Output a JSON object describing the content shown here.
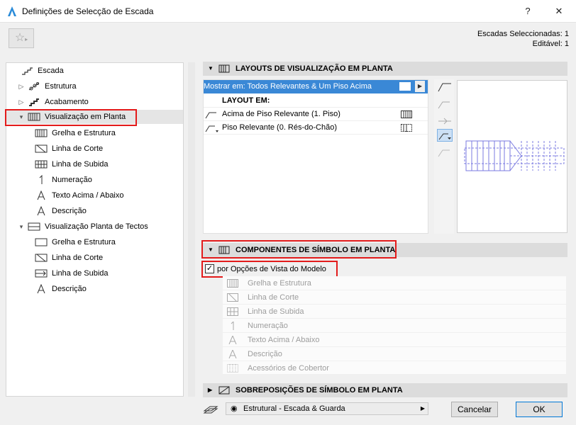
{
  "window": {
    "title": "Definições de Selecção de Escada",
    "help": "?",
    "close": "✕"
  },
  "selection_info": {
    "selected": "Escadas Seleccionadas: 1",
    "editable": "Editável: 1"
  },
  "tree": {
    "root": "Escada",
    "items": [
      {
        "label": "Estrutura",
        "icon": "stair-structure-icon"
      },
      {
        "label": "Acabamento",
        "icon": "stair-finish-icon"
      },
      {
        "label": "Visualização em Planta",
        "icon": "floor-plan-display-icon",
        "selected": true
      },
      {
        "label": "Grelha e Estrutura",
        "icon": "grid-structure-icon"
      },
      {
        "label": "Linha de Corte",
        "icon": "break-line-icon"
      },
      {
        "label": "Linha de Subida",
        "icon": "walking-line-icon"
      },
      {
        "label": "Numeração",
        "icon": "numbering-icon"
      },
      {
        "label": "Texto Acima / Abaixo",
        "icon": "up-down-text-icon"
      },
      {
        "label": "Descrição",
        "icon": "description-icon"
      },
      {
        "label": "Visualização Planta de Tectos",
        "icon": "ceiling-plan-icon"
      },
      {
        "label": "Grelha e Estrutura",
        "icon": "grid-structure-icon"
      },
      {
        "label": "Linha de Corte",
        "icon": "break-line-icon"
      },
      {
        "label": "Linha de Subida",
        "icon": "walking-line-icon"
      },
      {
        "label": "Descrição",
        "icon": "description-icon"
      }
    ]
  },
  "layouts": {
    "header": "LAYOUTS DE VISUALIZAÇÃO EM PLANTA",
    "show_on": "Mostrar em: Todos Relevantes & Um Piso Acima",
    "layout_on": "LAYOUT EM:",
    "rows": [
      {
        "label": "Acima de Piso Relevante (1. Piso)"
      },
      {
        "label": "Piso Relevante (0. Rés-do-Chão)"
      }
    ]
  },
  "components": {
    "header": "COMPONENTES DE SÍMBOLO EM PLANTA",
    "checkbox_label": "por Opções de Vista do Modelo",
    "checked": true,
    "items": [
      {
        "label": "Grelha e Estrutura"
      },
      {
        "label": "Linha de Corte"
      },
      {
        "label": "Linha de Subida"
      },
      {
        "label": "Numeração"
      },
      {
        "label": "Texto Acima / Abaixo"
      },
      {
        "label": "Descrição"
      },
      {
        "label": "Acessórios de Cobertor"
      }
    ]
  },
  "overrides": {
    "header": "SOBREPOSIÇÕES DE SÍMBOLO EM PLANTA"
  },
  "footer": {
    "model_view": "Estrutural - Escada & Guarda",
    "cancel": "Cancelar",
    "ok": "OK"
  },
  "colors": {
    "selection_blue": "#3a88d6",
    "highlight_red": "#e31b1b",
    "preview_stroke": "#7b7be0"
  }
}
